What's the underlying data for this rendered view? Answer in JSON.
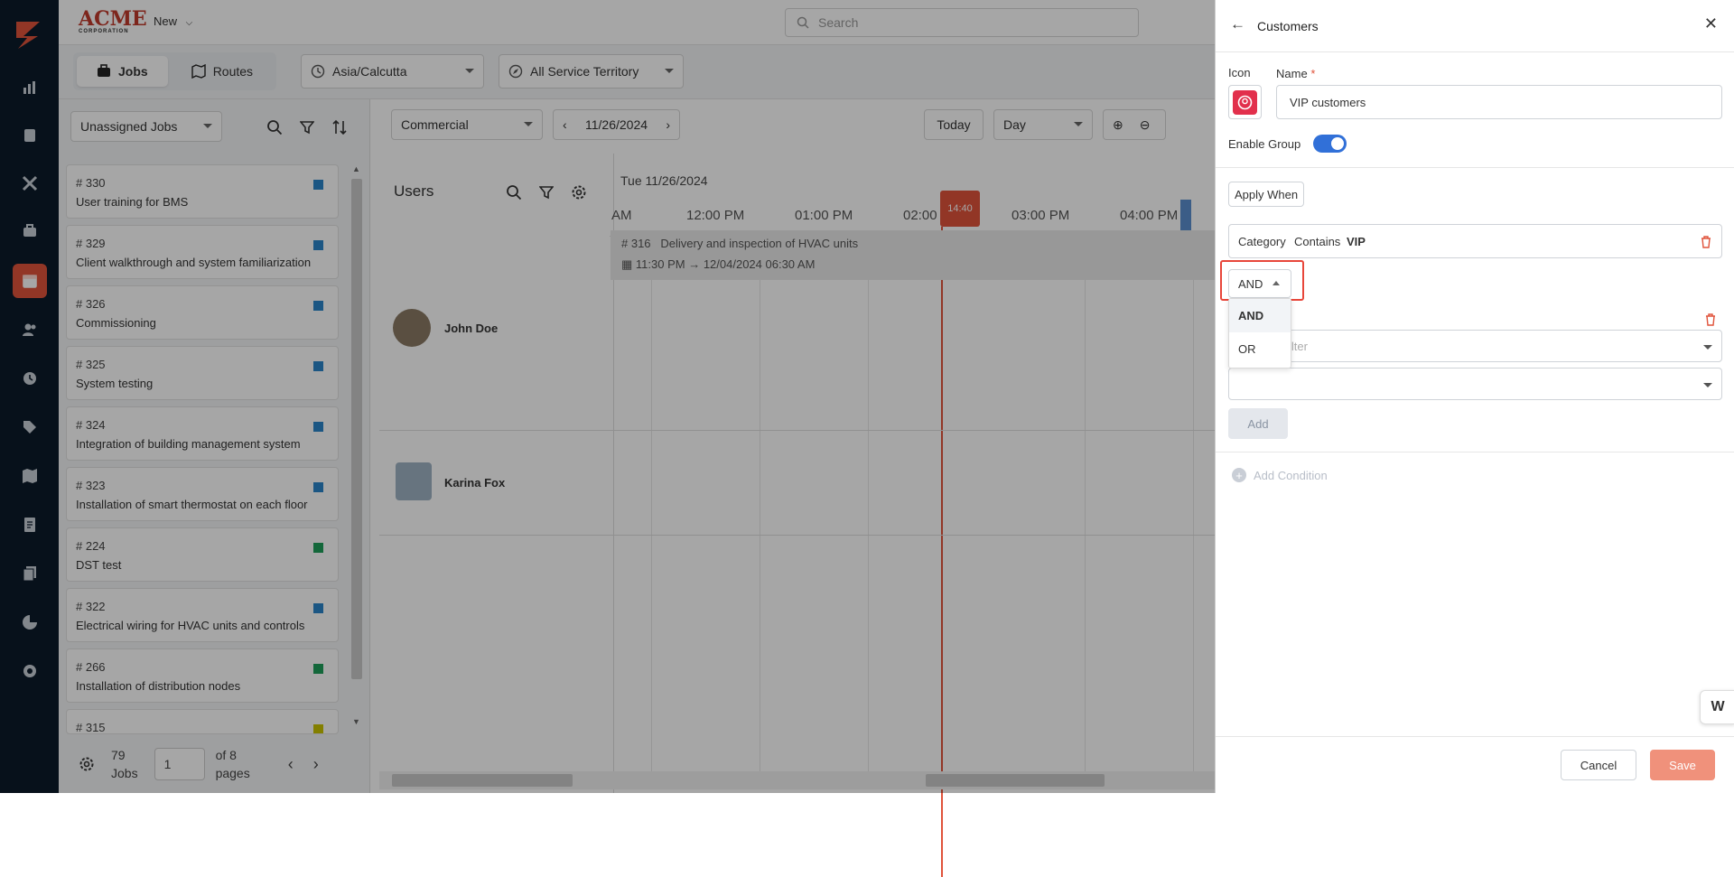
{
  "topbar": {
    "brand": "ACME",
    "brand_sub": "CORPORATION",
    "new_label": "New",
    "search_placeholder": "Search"
  },
  "toolbar": {
    "tab_jobs": "Jobs",
    "tab_routes": "Routes",
    "timezone": "Asia/Calcutta",
    "territory": "All Service Territory"
  },
  "jobs_panel": {
    "filter": "Unassigned Jobs",
    "items": [
      {
        "num": "# 330",
        "title": "User training for BMS",
        "color": "#2a85c9"
      },
      {
        "num": "# 329",
        "title": "Client walkthrough and system familiarization",
        "color": "#2a85c9"
      },
      {
        "num": "# 326",
        "title": "Commissioning",
        "color": "#2a85c9"
      },
      {
        "num": "# 325",
        "title": "System testing",
        "color": "#2a85c9"
      },
      {
        "num": "# 324",
        "title": "Integration of building management system",
        "color": "#2a85c9"
      },
      {
        "num": "# 323",
        "title": "Installation of smart thermostat on each floor",
        "color": "#2a85c9"
      },
      {
        "num": "# 224",
        "title": "DST test",
        "color": "#1e9e5a"
      },
      {
        "num": "# 322",
        "title": "Electrical wiring for HVAC units and controls",
        "color": "#2a85c9"
      },
      {
        "num": "# 266",
        "title": "Installation of distribution nodes",
        "color": "#1e9e5a"
      },
      {
        "num": "# 315",
        "title": "",
        "color": "#c9c400"
      }
    ],
    "count": "79",
    "count_label": "Jobs",
    "page": "1",
    "of_label": "of 8",
    "pages_label": "pages"
  },
  "scheduler": {
    "view_filter": "Commercial",
    "date": "11/26/2024",
    "today_label": "Today",
    "range": "Day",
    "users_title": "Users",
    "day_header": "Tue 11/26/2024",
    "hours": [
      "AM",
      "12:00 PM",
      "01:00 PM",
      "02:00 P",
      "03:00 PM",
      "04:00 PM"
    ],
    "now_marker": "14:40",
    "event_title": "# 316   Delivery and inspection of HVAC units",
    "event_time": "11:30 PM → 12/04/2024 06:30 AM",
    "users": [
      {
        "name": "John Doe"
      },
      {
        "name": "Karina Fox"
      }
    ]
  },
  "drawer": {
    "title": "Customers",
    "icon_label": "Icon",
    "name_label": "Name",
    "required_mark": "*",
    "name_value": "VIP customers",
    "enable_group_label": "Enable Group",
    "apply_when_label": "Apply When",
    "condition": {
      "field": "Category",
      "op": "Contains",
      "value": "VIP"
    },
    "logic_selected": "AND",
    "logic_options": [
      "AND",
      "OR"
    ],
    "filter_placeholder": "ilter",
    "add_label": "Add",
    "add_condition_label": "Add Condition",
    "cancel_label": "Cancel",
    "save_label": "Save",
    "colors": {
      "accent": "#3170d8",
      "danger": "#e0533b",
      "save": "#f0917b",
      "highlight": "#e8463a"
    }
  }
}
